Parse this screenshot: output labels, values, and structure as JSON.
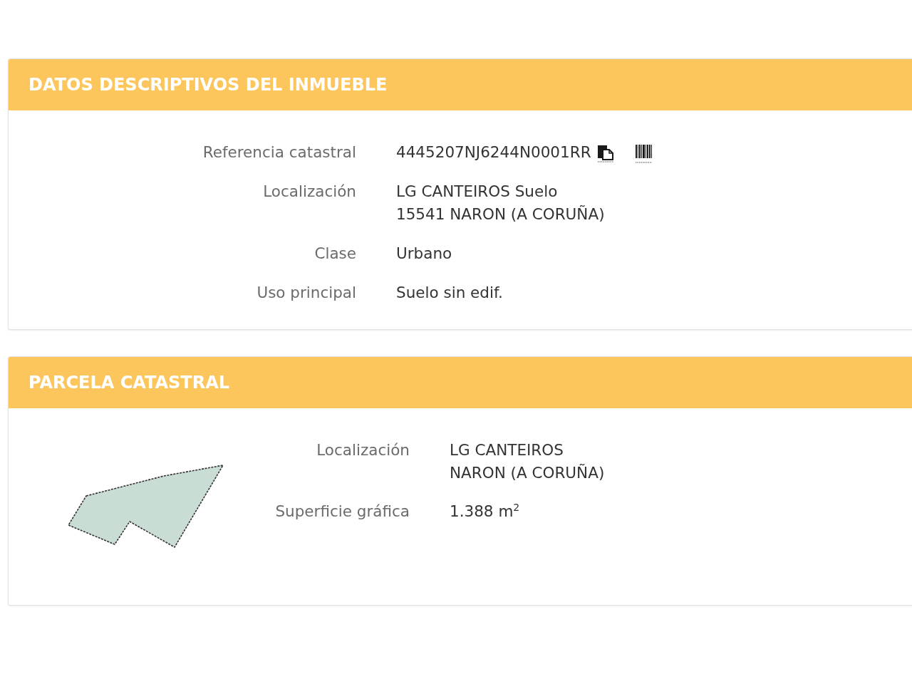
{
  "sections": [
    {
      "kind": "details",
      "title": "DATOS DESCRIPTIVOS DEL INMUEBLE",
      "fields": [
        {
          "kind": "reference",
          "label": "Referencia catastral",
          "lines": [
            "4445207NJ6244N0001RR"
          ]
        },
        {
          "kind": "text",
          "label": "Localización",
          "lines": [
            "LG CANTEIROS Suelo",
            "15541 NARON (A CORUÑA)"
          ]
        },
        {
          "kind": "text",
          "label": "Clase",
          "lines": [
            "Urbano"
          ]
        },
        {
          "kind": "text",
          "label": "Uso principal",
          "lines": [
            "Suelo sin edif."
          ]
        }
      ]
    },
    {
      "kind": "parcel",
      "title": "PARCELA CATASTRAL",
      "fields": [
        {
          "kind": "text",
          "label": "Localización",
          "lines": [
            "LG CANTEIROS",
            "NARON (A CORUÑA)"
          ]
        },
        {
          "kind": "text",
          "label": "Superficie gráfica",
          "lines": [
            "1.388 m$^{2}$"
          ]
        }
      ]
    }
  ]
}
